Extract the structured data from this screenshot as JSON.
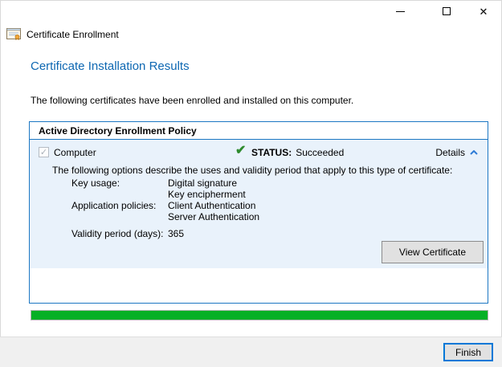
{
  "app": {
    "label": "Certificate Enrollment"
  },
  "page": {
    "heading": "Certificate Installation Results",
    "description": "The following certificates have been enrolled and installed on this computer."
  },
  "panel": {
    "header": "Active Directory Enrollment Policy",
    "certificate": {
      "name": "Computer",
      "checkbox_checked": true,
      "status_label": "STATUS:",
      "status_value": "Succeeded",
      "details_label": "Details",
      "details_expanded": true,
      "description": "The following options describe the uses and validity period that apply to this type of certificate:",
      "properties": [
        {
          "label": "Key usage:",
          "values": [
            "Digital signature",
            "Key encipherment"
          ]
        },
        {
          "label": "Application policies:",
          "values": [
            "Client Authentication",
            "Server Authentication"
          ]
        },
        {
          "label": "Validity period (days):",
          "values": [
            "365"
          ]
        }
      ],
      "view_certificate_label": "View Certificate"
    }
  },
  "progress": {
    "percent": 100,
    "bar_color": "#06b025"
  },
  "footer": {
    "finish_label": "Finish"
  },
  "colors": {
    "heading_blue": "#0d67b2",
    "panel_border_blue": "#1c77c3",
    "panel_fill_blue": "#e9f2fb",
    "status_check_green": "#2e8b2e",
    "focus_border_blue": "#0078d7"
  }
}
